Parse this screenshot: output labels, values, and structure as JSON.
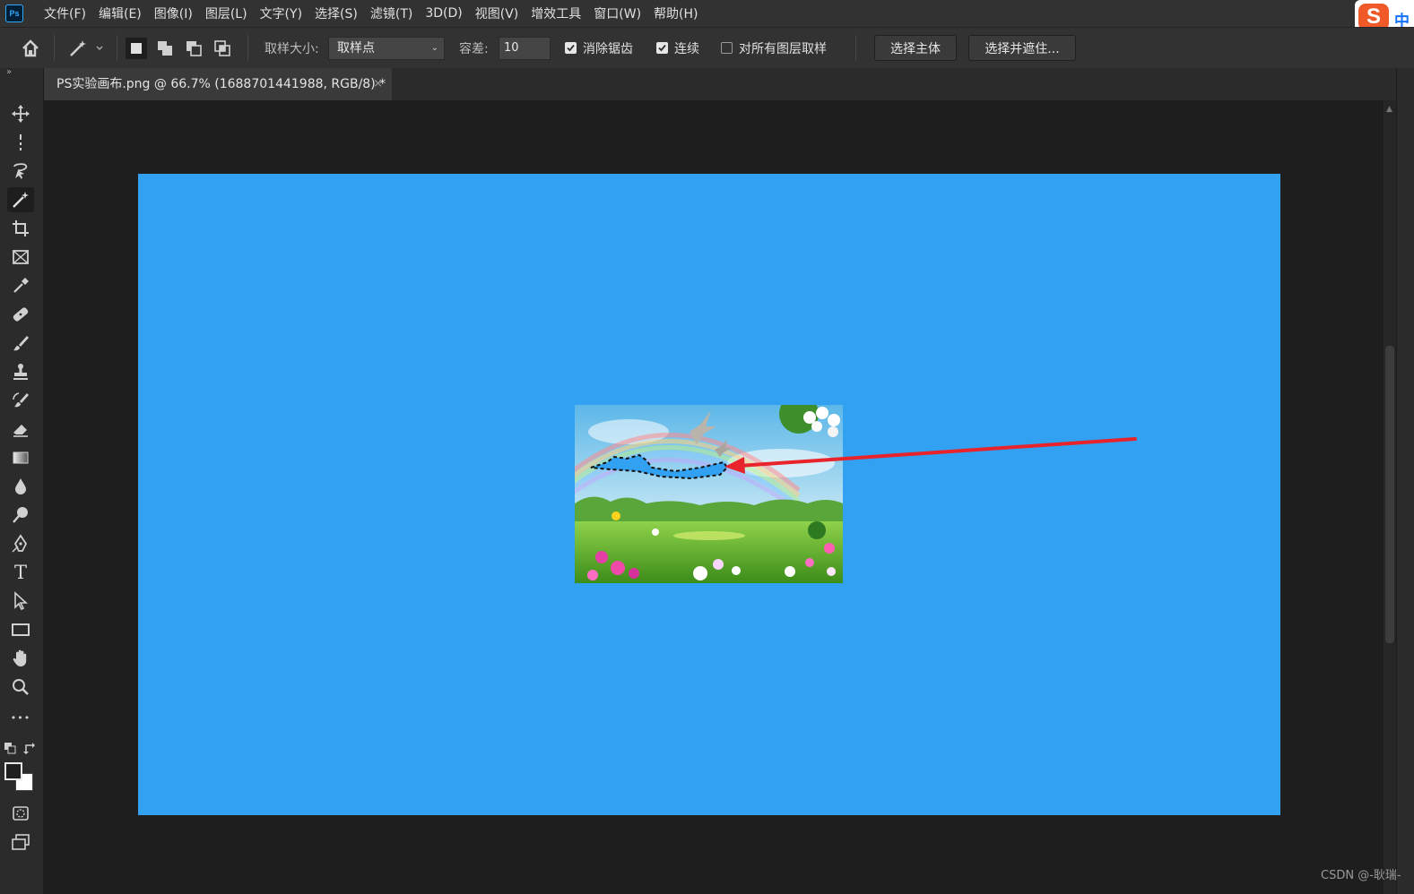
{
  "menu": {
    "logo": "Ps",
    "items": [
      "文件(F)",
      "编辑(E)",
      "图像(I)",
      "图层(L)",
      "文字(Y)",
      "选择(S)",
      "滤镜(T)",
      "3D(D)",
      "视图(V)",
      "增效工具",
      "窗口(W)",
      "帮助(H)"
    ]
  },
  "ime": {
    "logo": "S",
    "mode": "中"
  },
  "options": {
    "sample_size_label": "取样大小:",
    "sample_size_value": "取样点",
    "tolerance_label": "容差:",
    "tolerance_value": "10",
    "anti_alias_label": "消除锯齿",
    "anti_alias_checked": true,
    "contiguous_label": "连续",
    "contiguous_checked": true,
    "all_layers_label": "对所有图层取样",
    "all_layers_checked": false,
    "select_subject_label": "选择主体",
    "select_mask_label": "选择并遮住..."
  },
  "document": {
    "tab_title": "PS实验画布.png @ 66.7% (1688701441988, RGB/8) *",
    "close_glyph": "×"
  },
  "colors": {
    "canvas_background": "#32a1f1",
    "annotation_arrow": "#e8232c",
    "foreground": "#1e1e1e",
    "background": "#ffffff"
  },
  "tools": [
    "move-tool",
    "marquee-tool",
    "object-selection-tool",
    "magic-wand-tool",
    "crop-tool",
    "frame-tool",
    "eyedropper-tool",
    "healing-brush-tool",
    "brush-tool",
    "clone-stamp-tool",
    "history-brush-tool",
    "eraser-tool",
    "gradient-tool",
    "blur-tool",
    "dodge-tool",
    "pen-tool",
    "type-tool",
    "path-selection-tool",
    "rectangle-tool",
    "hand-tool",
    "zoom-tool",
    "more-tools"
  ],
  "type_tool_glyph": "T",
  "more_tools_glyph": "•••",
  "watermark": "CSDN @-耿瑞-"
}
